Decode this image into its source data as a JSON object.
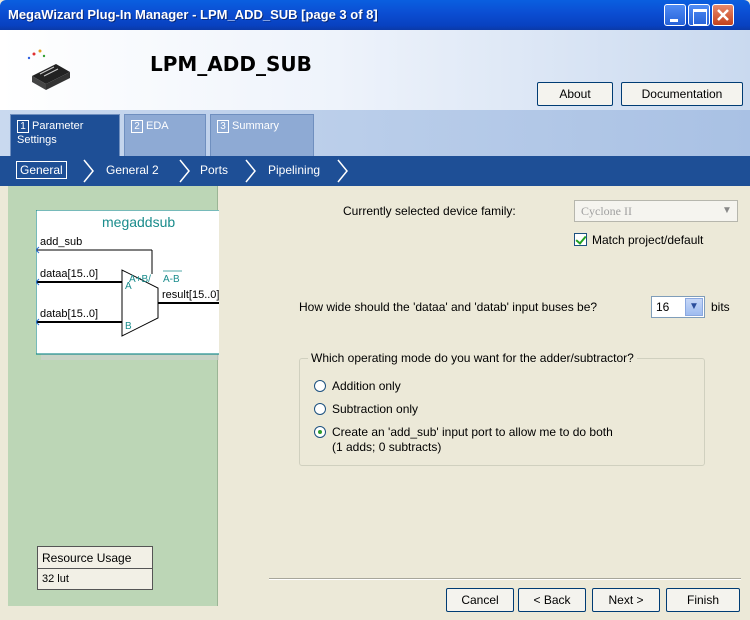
{
  "window": {
    "title": "MegaWizard Plug-In Manager - LPM_ADD_SUB [page 3 of 8]"
  },
  "header": {
    "component_name": "LPM_ADD_SUB",
    "about_label": "About",
    "documentation_label": "Documentation"
  },
  "tabs": [
    {
      "num": "1",
      "label": "Parameter Settings"
    },
    {
      "num": "2",
      "label": "EDA"
    },
    {
      "num": "3",
      "label": "Summary"
    }
  ],
  "subtabs": [
    "General",
    "General 2",
    "Ports",
    "Pipelining"
  ],
  "symbol": {
    "name": "megaddsub",
    "ports": [
      "add_sub",
      "dataa[15..0]",
      "datab[15..0]",
      "result[15..0]"
    ],
    "pin_a": "A",
    "pin_b": "B",
    "expr": "A+B/",
    "expr_bar": "A-B"
  },
  "resource": {
    "title": "Resource Usage",
    "value": "32 lut"
  },
  "device": {
    "label": "Currently selected device family:",
    "value": "Cyclone II",
    "match_label": "Match project/default",
    "match_checked": true
  },
  "width": {
    "question": "How wide should the 'dataa' and 'datab' input buses be?",
    "value": "16",
    "unit": "bits"
  },
  "mode": {
    "legend": "Which operating mode do you want for the adder/subtractor?",
    "options": [
      "Addition only",
      "Subtraction only",
      "Create an 'add_sub' input port to allow me to do both"
    ],
    "option3_note": "(1 adds; 0 subtracts)",
    "selected": 2
  },
  "footer": {
    "cancel": "Cancel",
    "back": "< Back",
    "next": "Next >",
    "finish": "Finish"
  },
  "colors": {
    "titlebar": "#0b4fd4",
    "nav_bar": "#1e4f96",
    "left_panel": "#bcd6b6",
    "symbol_accent": "#1a8c8c"
  }
}
